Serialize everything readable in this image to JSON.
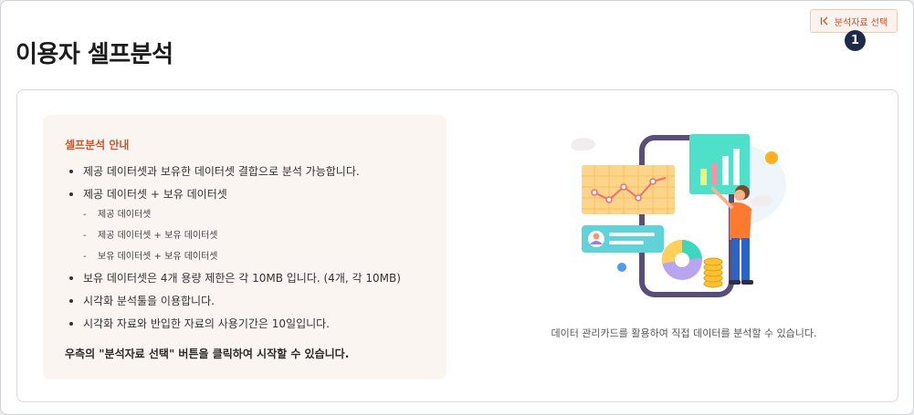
{
  "header": {
    "page_title": "이용자 셀프분석",
    "select_button_label": "분석자료 선택",
    "step_badge": "1"
  },
  "guide": {
    "title": "셀프분석 안내",
    "items": [
      "제공 데이터셋과 보유한 데이터셋 결합으로 분석 가능합니다.",
      "제공 데이터셋 + 보유 데이터셋",
      "제공 데이터셋",
      "제공 데이터셋 + 보유 데이터셋",
      "보유 데이터셋 + 보유 데이터셋",
      "보유 데이터셋은 4개 용량 제한은 각 10MB 입니다. (4개, 각 10MB)",
      "시각화 분석툴을 이용합니다.",
      "시각화 자료와 반입한 자료의 사용기간은 10일입니다."
    ],
    "footer": "우측의 \"분석자료 선택\" 버튼을 클릭하여 시작할 수 있습니다."
  },
  "illustration": {
    "icon": "data-analysis-illustration",
    "caption": "데이터 관리카드를 활용하여 직접 데이터를 분석할 수 있습니다."
  },
  "colors": {
    "accent": "#d0532a",
    "badge": "#1e2a4a",
    "guide_bg": "#faf5f1"
  }
}
